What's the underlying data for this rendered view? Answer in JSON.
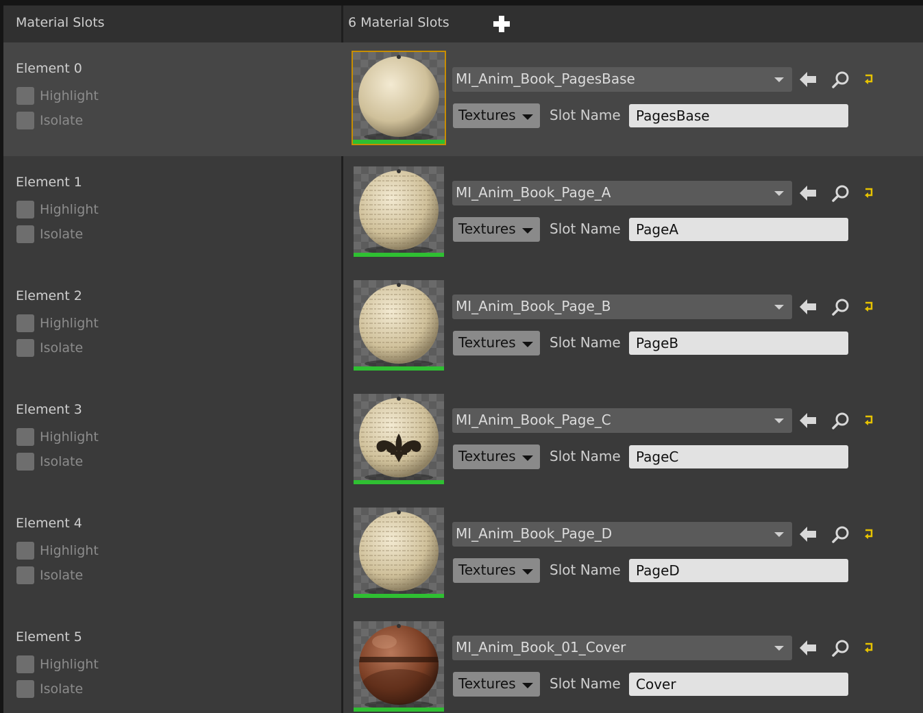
{
  "header": {
    "left_title": "Material Slots",
    "right_title": "6 Material Slots"
  },
  "check_labels": {
    "highlight": "Highlight",
    "isolate": "Isolate"
  },
  "labels": {
    "textures": "Textures",
    "slot_name": "Slot Name"
  },
  "slots": [
    {
      "element": "Element 0",
      "material": "MI_Anim_Book_PagesBase",
      "slot_name": "PagesBase",
      "selected": true,
      "thumb": "plain"
    },
    {
      "element": "Element 1",
      "material": "MI_Anim_Book_Page_A",
      "slot_name": "PageA",
      "selected": false,
      "thumb": "text"
    },
    {
      "element": "Element 2",
      "material": "MI_Anim_Book_Page_B",
      "slot_name": "PageB",
      "selected": false,
      "thumb": "text"
    },
    {
      "element": "Element 3",
      "material": "MI_Anim_Book_Page_C",
      "slot_name": "PageC",
      "selected": false,
      "thumb": "fleur"
    },
    {
      "element": "Element 4",
      "material": "MI_Anim_Book_Page_D",
      "slot_name": "PageD",
      "selected": false,
      "thumb": "text"
    },
    {
      "element": "Element 5",
      "material": "MI_Anim_Book_01_Cover",
      "slot_name": "Cover",
      "selected": false,
      "thumb": "leather"
    }
  ],
  "icons": {
    "add": "plus-icon",
    "use_selected": "arrow-left-icon",
    "browse": "search-icon",
    "reset": "reset-arrow-icon"
  },
  "colors": {
    "selected_border": "#c88e00",
    "thumb_bar": "#2fbf32",
    "reset_icon": "#e6c200"
  }
}
